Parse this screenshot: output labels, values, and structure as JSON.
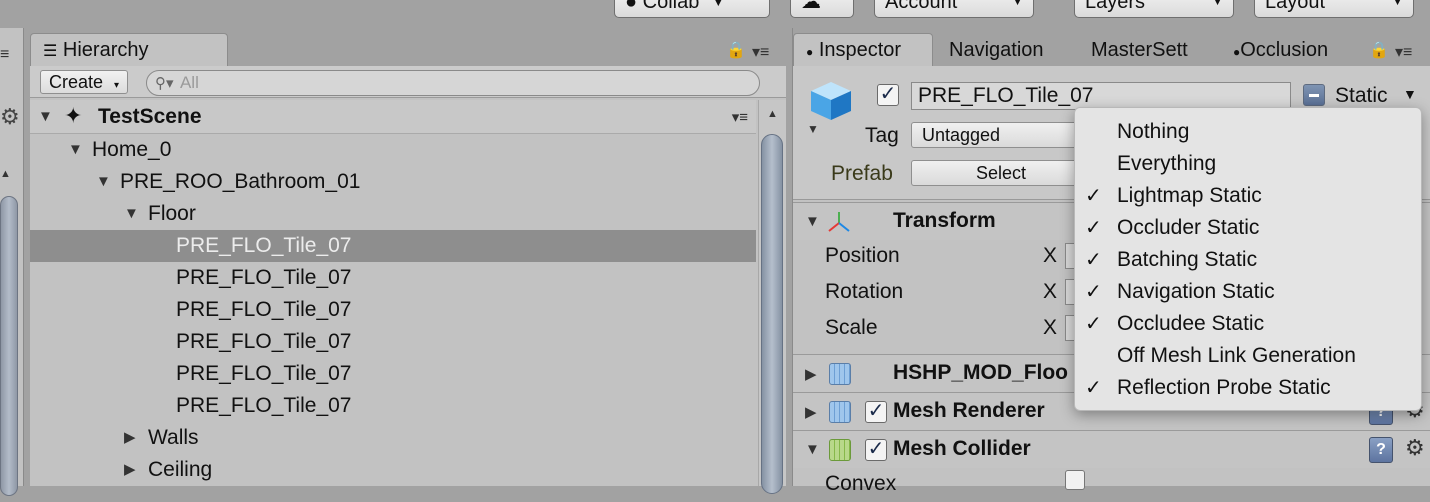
{
  "toolbar": {
    "collab_label": "Collab",
    "account_label": "Account",
    "layers_label": "Layers",
    "layout_label": "Layout"
  },
  "hierarchy": {
    "tab_label": "Hierarchy",
    "create_label": "Create",
    "search_placeholder": "All",
    "scene_name": "TestScene",
    "tree": [
      {
        "label": "Home_0",
        "expanded": true,
        "depth": 1
      },
      {
        "label": "PRE_ROO_Bathroom_01",
        "expanded": true,
        "depth": 2
      },
      {
        "label": "Floor",
        "expanded": true,
        "depth": 3
      },
      {
        "label": "PRE_FLO_Tile_07",
        "selected": true,
        "depth": 4
      },
      {
        "label": "PRE_FLO_Tile_07",
        "depth": 4
      },
      {
        "label": "PRE_FLO_Tile_07",
        "depth": 4
      },
      {
        "label": "PRE_FLO_Tile_07",
        "depth": 4
      },
      {
        "label": "PRE_FLO_Tile_07",
        "depth": 4
      },
      {
        "label": "PRE_FLO_Tile_07",
        "depth": 4
      },
      {
        "label": "Walls",
        "expanded": false,
        "depth": 3
      },
      {
        "label": "Ceiling",
        "expanded": false,
        "depth": 3
      }
    ]
  },
  "inspector": {
    "tabs": [
      "Inspector",
      "Navigation",
      "MasterSett",
      "Occlusion"
    ],
    "object_name": "PRE_FLO_Tile_07",
    "static_label": "Static",
    "tag_label": "Tag",
    "tag_value": "Untagged",
    "prefab_label": "Prefab",
    "prefab_select_label": "Select",
    "components": [
      {
        "name": "Transform"
      },
      {
        "name": "HSHP_MOD_Floo"
      },
      {
        "name": "Mesh Renderer"
      },
      {
        "name": "Mesh Collider"
      }
    ],
    "transform_props": [
      {
        "label": "Position",
        "axis": "X"
      },
      {
        "label": "Rotation",
        "axis": "X"
      },
      {
        "label": "Scale",
        "axis": "X"
      }
    ],
    "convex_label": "Convex"
  },
  "static_popup": {
    "items": [
      {
        "label": "Nothing",
        "checked": false
      },
      {
        "label": "Everything",
        "checked": false
      },
      {
        "label": "Lightmap Static",
        "checked": true
      },
      {
        "label": "Occluder Static",
        "checked": true
      },
      {
        "label": "Batching Static",
        "checked": true
      },
      {
        "label": "Navigation Static",
        "checked": true
      },
      {
        "label": "Occludee Static",
        "checked": true
      },
      {
        "label": "Off Mesh Link Generation",
        "checked": false
      },
      {
        "label": "Reflection Probe Static",
        "checked": true
      }
    ],
    "check_glyph": "✓"
  }
}
